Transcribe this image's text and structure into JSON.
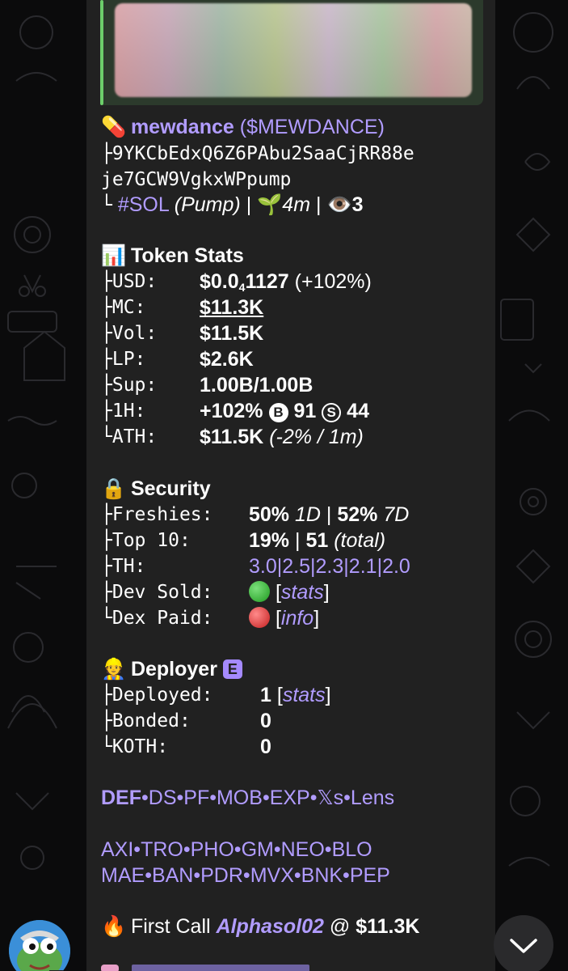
{
  "token": {
    "pill_emoji": "💊",
    "name": "mewdance",
    "ticker": "($MEWDANCE)",
    "address_line1": "9YKCbEdxQ6Z6PAbu2SaaCjRR88e",
    "address_line2": "je7GCW9VgkxWPpump",
    "chain": "#SOL",
    "platform": "(Pump)",
    "age": "4m",
    "viewers": "3"
  },
  "stats": {
    "heading": "Token Stats",
    "usd_label": "USD:",
    "usd_value_prefix": "$0.0",
    "usd_value_sub": "4",
    "usd_value_rest": "1127",
    "usd_change": "(+102%)",
    "mc_label": "MC:",
    "mc_value": "$11.3K",
    "vol_label": "Vol:",
    "vol_value": "$11.5K",
    "lp_label": "LP:",
    "lp_value": "$2.6K",
    "sup_label": "Sup:",
    "sup_value": "1.00B/1.00B",
    "h1_label": "1H:",
    "h1_change": "+102%",
    "h1_buy_icon": "B",
    "h1_buys": "91",
    "h1_sell_icon": "S",
    "h1_sells": "44",
    "ath_label": "ATH:",
    "ath_value": "$11.5K",
    "ath_detail": "(-2% / 1m)"
  },
  "security": {
    "heading": "Security",
    "freshies_label": "Freshies:",
    "freshies_1d": "50%",
    "freshies_1d_unit": "1D",
    "freshies_7d": "52%",
    "freshies_7d_unit": "7D",
    "top10_label": "Top 10:",
    "top10_pct": "19%",
    "top10_count": "51",
    "top10_total": "(total)",
    "th_label": "TH:",
    "th_values": [
      "3.0",
      "2.5",
      "2.3",
      "2.1",
      "2.0"
    ],
    "dev_sold_label": "Dev Sold:",
    "dev_sold_link": "stats",
    "dex_paid_label": "Dex Paid:",
    "dex_paid_link": "info",
    "green_color": "#3fbf3f",
    "red_color": "#e03a3a"
  },
  "deployer": {
    "heading": "Deployer",
    "badge": "E",
    "deployed_label": "Deployed:",
    "deployed_value": "1",
    "deployed_link": "stats",
    "bonded_label": "Bonded:",
    "bonded_value": "0",
    "koth_label": "KOTH:",
    "koth_value": "0"
  },
  "links_row1": [
    "DEF",
    "DS",
    "PF",
    "MOB",
    "EXP",
    "𝕏s",
    "Lens"
  ],
  "links_row2": [
    "AXI",
    "TRO",
    "PHO",
    "GM",
    "NEO",
    "BLO"
  ],
  "links_row3": [
    "MAE",
    "BAN",
    "PDR",
    "MVX",
    "BNK",
    "PEP"
  ],
  "first_call": {
    "label": "First Call",
    "caller": "Alphasol02",
    "at": "@",
    "value": "$11.3K"
  },
  "colors": {
    "accent": "#b19cff",
    "bubble": "#212121",
    "preview_bar": "#6ccf6a"
  },
  "icons": {
    "pill": "pill-icon",
    "chart": "bar-chart-icon",
    "lock": "lock-icon",
    "worker": "construction-worker-icon",
    "fire": "fire-icon",
    "sprout": "seedling-icon",
    "eye": "eye-icon",
    "scroll": "chevron-down-icon"
  }
}
